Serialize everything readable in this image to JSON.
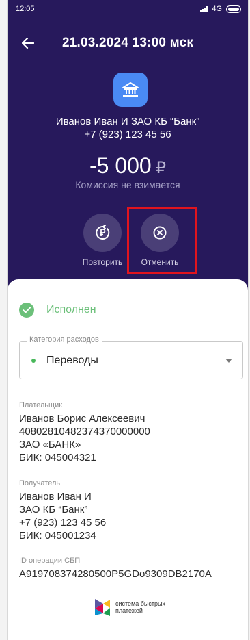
{
  "status_bar": {
    "time": "12:05",
    "network": "4G"
  },
  "header": {
    "title": "21.03.2024 13:00 мск"
  },
  "recipient": {
    "line1": "Иванов Иван И  ЗАО КБ “Банк”",
    "line2": "+7 (923) 123 45 56"
  },
  "amount": {
    "value": "-5 000",
    "currency": "₽",
    "commission": "Комиссия не взимается"
  },
  "actions": {
    "repeat_label": "Повторить",
    "cancel_label": "Отменить"
  },
  "status": {
    "label": "Исполнен",
    "color": "#6cc07a"
  },
  "category": {
    "legend": "Категория расходов",
    "value": "Переводы"
  },
  "payer": {
    "caption": "Плательщик",
    "name": "Иванов Борис Алексеевич",
    "account": "40802810482374370000000",
    "bank": "ЗАО «БАНК»",
    "bik": "БИК: 045004321"
  },
  "payee": {
    "caption": "Получатель",
    "name": "Иванов Иван И",
    "bank": "ЗАО КБ  “Банк”",
    "phone": "+7 (923) 123 45 56",
    "bik": "БИК: 045001234"
  },
  "operation": {
    "caption": "ID операции СБП",
    "id": "A919708374280500P5GDo9309DB2170A"
  },
  "footer": {
    "logo_line1": "система быстрых",
    "logo_line2": "платежей"
  },
  "colors": {
    "background": "#27195c",
    "accent_blue": "#4a8af4",
    "highlight": "#e0141e"
  }
}
